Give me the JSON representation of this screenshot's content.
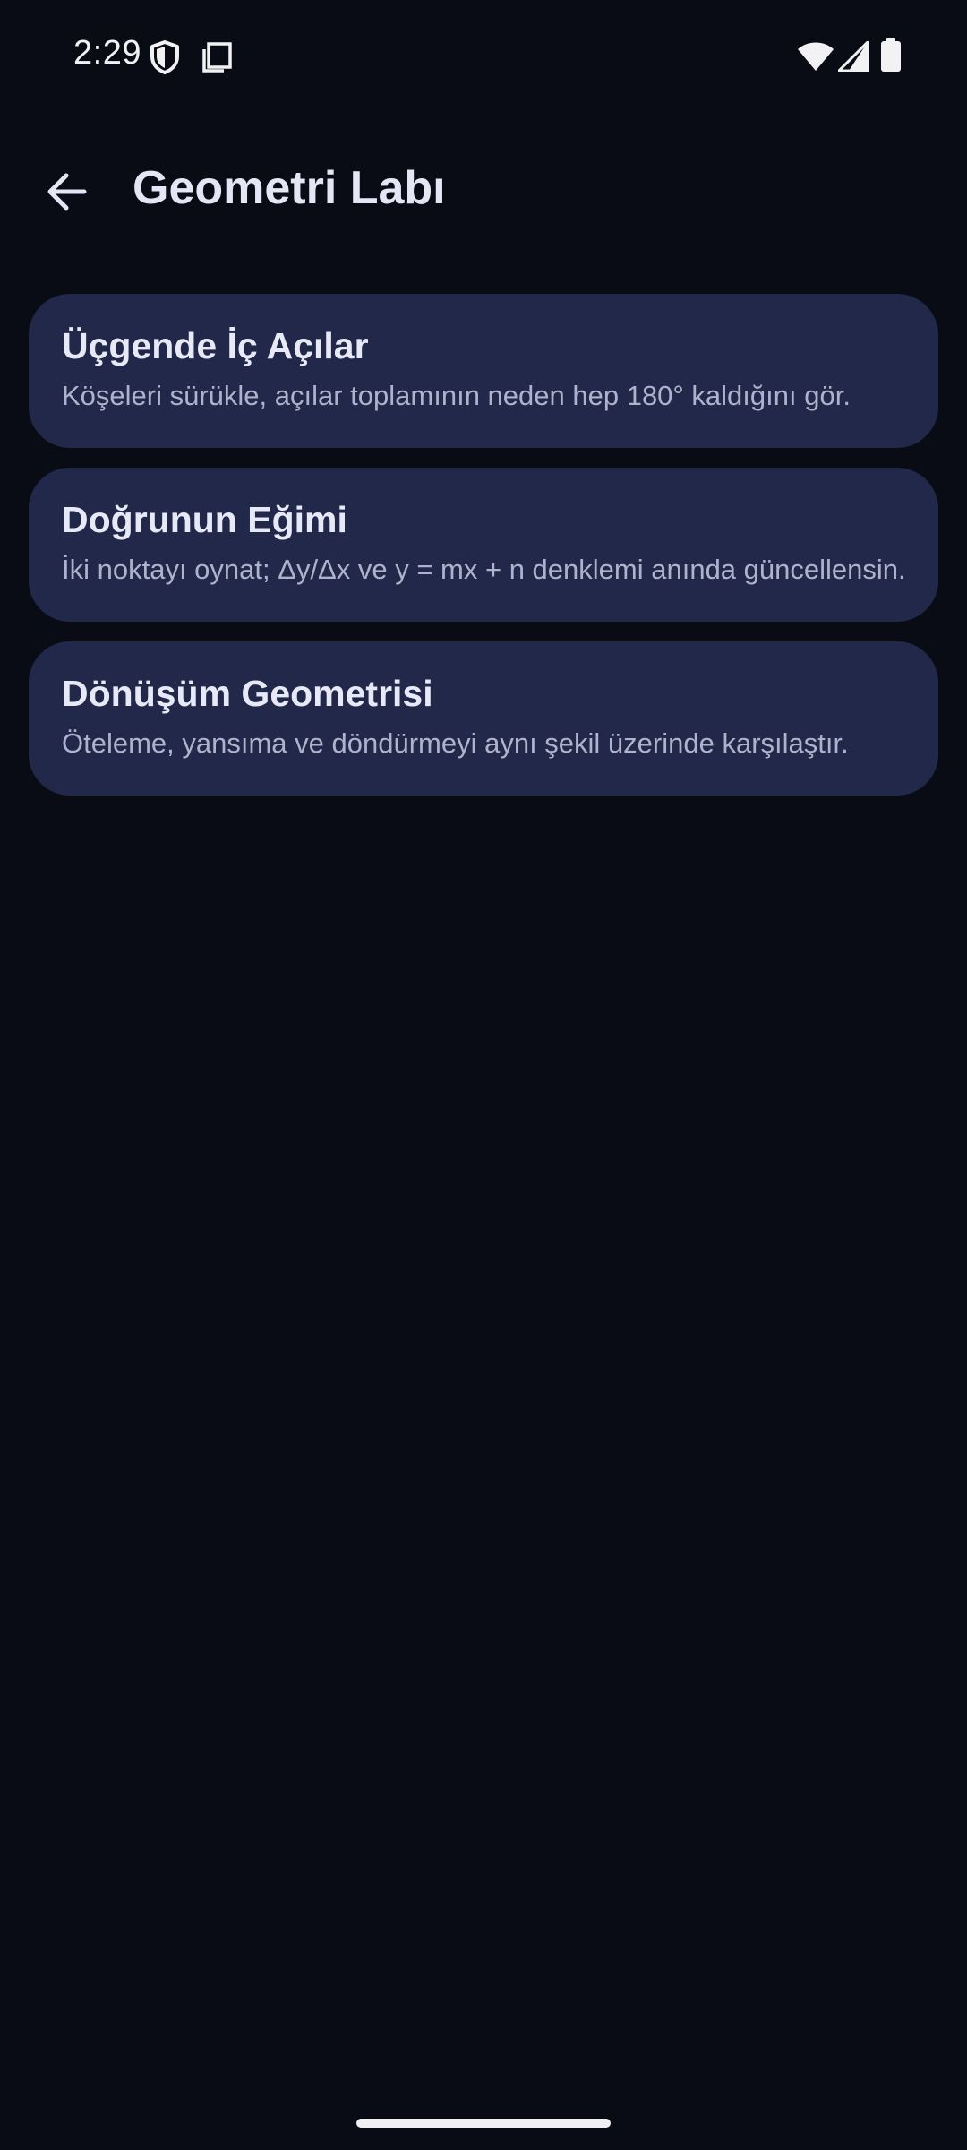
{
  "status_bar": {
    "time": "2:29"
  },
  "app_bar": {
    "title": "Geometri Labı",
    "back_icon": "arrow-back-icon"
  },
  "cards": [
    {
      "title": "Üçgende İç Açılar",
      "description": "Köşeleri sürükle, açılar toplamının neden hep 180° kaldığını gör."
    },
    {
      "title": "Doğrunun Eğimi",
      "description": "İki noktayı oynat; Δy/Δx ve y = mx + n denklemi anında güncellensin."
    },
    {
      "title": "Dönüşüm Geometrisi",
      "description": "Öteleme, yansıma ve döndürmeyi aynı şekil üzerinde karşılaştır."
    }
  ],
  "colors": {
    "background": "#0a0c15",
    "card": "#22284a",
    "title_text": "#e4e6f5",
    "secondary_text": "#aeb2cb"
  }
}
